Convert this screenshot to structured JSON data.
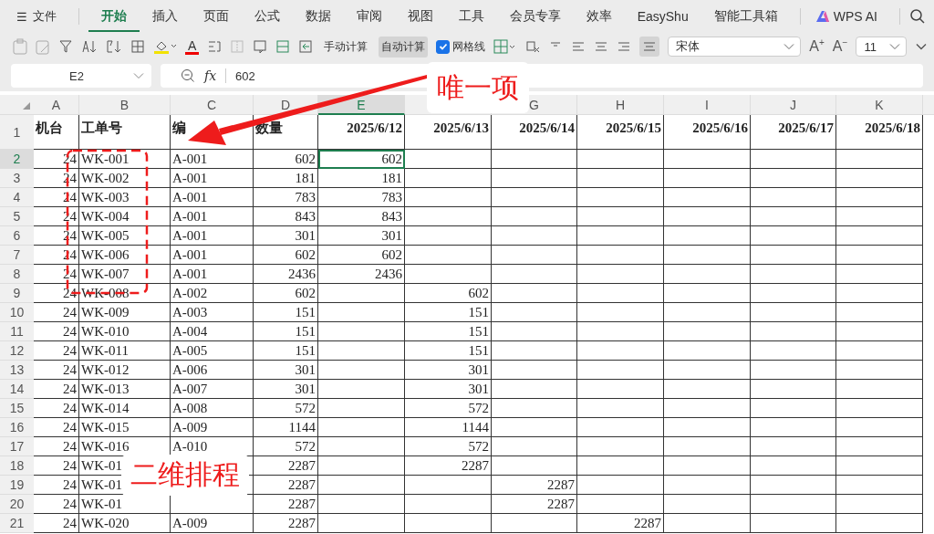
{
  "menu_bar": {
    "menu_glyph": "☰",
    "file": "文件",
    "tabs": [
      {
        "label": "开始",
        "selected": true
      },
      {
        "label": "插入",
        "selected": false
      },
      {
        "label": "页面",
        "selected": false
      },
      {
        "label": "公式",
        "selected": false
      },
      {
        "label": "数据",
        "selected": false
      },
      {
        "label": "审阅",
        "selected": false
      },
      {
        "label": "视图",
        "selected": false
      },
      {
        "label": "工具",
        "selected": false
      },
      {
        "label": "会员专享",
        "selected": false
      },
      {
        "label": "效率",
        "selected": false
      },
      {
        "label": "EasyShu",
        "selected": false
      },
      {
        "label": "智能工具箱",
        "selected": false
      }
    ],
    "ai_tab": "WPS AI"
  },
  "toolbar": {
    "font_color_glyph": "A",
    "manual_calc": "手动计算",
    "auto_calc": {
      "label": "自动计算",
      "pressed": true
    },
    "gridlines": {
      "label": "网格线",
      "checked": true
    },
    "font": "宋体",
    "grow_font_glyph": "A",
    "grow_font_sign": "+",
    "shrink_font_glyph": "A",
    "shrink_font_sign": "−",
    "font_size": "11"
  },
  "formula_bar": {
    "name_box": "E2",
    "fx": "fx",
    "formula": "602"
  },
  "sheet": {
    "columns": [
      {
        "letter": "A",
        "selected": false
      },
      {
        "letter": "B",
        "selected": false
      },
      {
        "letter": "C",
        "selected": false
      },
      {
        "letter": "D",
        "selected": false
      },
      {
        "letter": "E",
        "selected": true
      },
      {
        "selected": false
      },
      {
        "letter": "G",
        "selected": false
      },
      {
        "letter": "H",
        "selected": false
      },
      {
        "letter": "I",
        "selected": false
      },
      {
        "letter": "J",
        "selected": false
      },
      {
        "letter": "K",
        "selected": false
      }
    ],
    "rows": [
      {
        "number": "1",
        "selected": false,
        "cells": {
          "A": "机台",
          "B": "工单号",
          "C": "编",
          "D": "数量",
          "E": "2025/6/12",
          "F": "2025/6/13",
          "G": "2025/6/14",
          "H": "2025/6/15",
          "I": "2025/6/16",
          "J": "2025/6/17",
          "K": "2025/6/18"
        }
      },
      {
        "number": "2",
        "selected": true,
        "cells": {
          "A": "24",
          "B": "WK-001",
          "C": "A-001",
          "D": "602",
          "E": "602"
        }
      },
      {
        "number": "3",
        "selected": false,
        "cells": {
          "A": "24",
          "B": "WK-002",
          "C": "A-001",
          "D": "181",
          "E": "181"
        }
      },
      {
        "number": "4",
        "selected": false,
        "cells": {
          "A": "24",
          "B": "WK-003",
          "C": "A-001",
          "D": "783",
          "E": "783"
        }
      },
      {
        "number": "5",
        "selected": false,
        "cells": {
          "A": "24",
          "B": "WK-004",
          "C": "A-001",
          "D": "843",
          "E": "843"
        }
      },
      {
        "number": "6",
        "selected": false,
        "cells": {
          "A": "24",
          "B": "WK-005",
          "C": "A-001",
          "D": "301",
          "E": "301"
        }
      },
      {
        "number": "7",
        "selected": false,
        "cells": {
          "A": "24",
          "B": "WK-006",
          "C": "A-001",
          "D": "602",
          "E": "602"
        }
      },
      {
        "number": "8",
        "selected": false,
        "cells": {
          "A": "24",
          "B": "WK-007",
          "C": "A-001",
          "D": "2436",
          "E": "2436"
        }
      },
      {
        "number": "9",
        "selected": false,
        "cells": {
          "A": "24",
          "B": "WK-008",
          "C": "A-002",
          "D": "602",
          "F": "602"
        }
      },
      {
        "number": "10",
        "selected": false,
        "cells": {
          "A": "24",
          "B": "WK-009",
          "C": "A-003",
          "D": "151",
          "F": "151"
        }
      },
      {
        "number": "11",
        "selected": false,
        "cells": {
          "A": "24",
          "B": "WK-010",
          "C": "A-004",
          "D": "151",
          "F": "151"
        }
      },
      {
        "number": "12",
        "selected": false,
        "cells": {
          "A": "24",
          "B": "WK-011",
          "C": "A-005",
          "D": "151",
          "F": "151"
        }
      },
      {
        "number": "13",
        "selected": false,
        "cells": {
          "A": "24",
          "B": "WK-012",
          "C": "A-006",
          "D": "301",
          "F": "301"
        }
      },
      {
        "number": "14",
        "selected": false,
        "cells": {
          "A": "24",
          "B": "WK-013",
          "C": "A-007",
          "D": "301",
          "F": "301"
        }
      },
      {
        "number": "15",
        "selected": false,
        "cells": {
          "A": "24",
          "B": "WK-014",
          "C": "A-008",
          "D": "572",
          "F": "572"
        }
      },
      {
        "number": "16",
        "selected": false,
        "cells": {
          "A": "24",
          "B": "WK-015",
          "C": "A-009",
          "D": "1144",
          "F": "1144"
        }
      },
      {
        "number": "17",
        "selected": false,
        "cells": {
          "A": "24",
          "B": "WK-016",
          "C": "A-010",
          "D": "572",
          "F": "572"
        }
      },
      {
        "number": "18",
        "selected": false,
        "cells": {
          "A": "24",
          "B": "WK-01",
          "D": "2287",
          "F": "2287"
        }
      },
      {
        "number": "19",
        "selected": false,
        "cells": {
          "A": "24",
          "B": "WK-01",
          "D": "2287",
          "G": "2287"
        }
      },
      {
        "number": "20",
        "selected": false,
        "cells": {
          "A": "24",
          "B": "WK-01",
          "D": "2287",
          "G": "2287"
        }
      },
      {
        "number": "21",
        "selected": false,
        "cells": {
          "A": "24",
          "B": "WK-020",
          "C": "A-009",
          "D": "2287",
          "H": "2287"
        }
      }
    ]
  },
  "annotations": {
    "arrow_label": "唯一项",
    "box_label": "二维排程"
  }
}
